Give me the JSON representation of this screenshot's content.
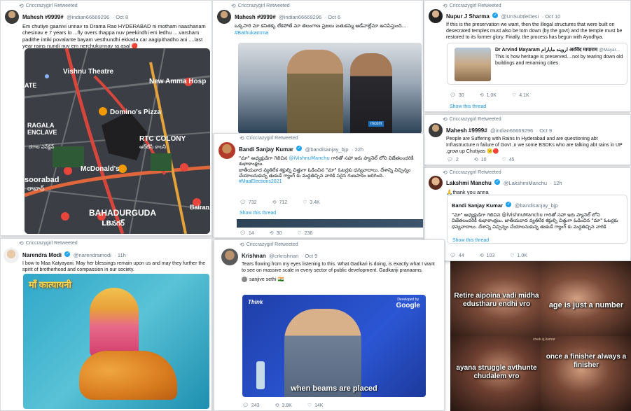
{
  "tweets": {
    "t1": {
      "retweet_label": "Criccrazygirl Retweeted",
      "name": "Mahesh #9999#",
      "handle": "@indian66669296",
      "date": "· Oct 8",
      "text": "Em chutiye gaanivi unnav ra Drama Rao HYDERABAD ni motham naashanam chesinav e 7 years lo ...fly overs thappa nuv peekindhi em ledhu ....varsham padithe intiki povalante bayam vesthundhi ekkada car aagipithadho ani ....last year rains nundi nuv em nerchukunnav ra asal 🔴",
      "map": {
        "labels": [
          "Vishnu Theatre",
          "New Amma Hosp",
          "Domino's Pizza",
          "RAGALA ENCLAVE",
          "రగాల ఎన్‌క్లేవ్",
          "RTC COLONY",
          "ఆర్‌టీసీ కాలనీ",
          "McDonald's",
          "soorabad",
          "రాబాద్",
          "BAHADURGUDA",
          "LBనగర్",
          "Bairan",
          "ATE"
        ]
      }
    },
    "t2": {
      "retweet_label": "Criccrazygirl Retweeted",
      "name": "Mahesh #9999#",
      "handle": "@indian66669296",
      "date": "· Oct 6",
      "text": "ఒక్కసారి మా కవితక్క లేకపోతే మా తెలంగాణ ప్రజలు బతుకమ్మ ఆడేవాల్లేమా అనిపిస్తుంది...",
      "hashtag": "#Bathukamma",
      "badges": [
        "mcom",
        "mcom"
      ]
    },
    "t3": {
      "retweet_label": "Criccrazygirl Retweeted",
      "name": "Nupur J Sharma",
      "handle": "@UnSubtleDesi",
      "date": "· Oct 10",
      "text": "If this is the preservation we want, then the illegal structures that were built on desecrated temples must also be torn down (by the govt) and the temple must be restored to its former glory. Finally, the process has begun with Ayodhya.",
      "quote_name": "Dr Arvind Mayaram ارویند مایارام अरविंद मायाराम",
      "quote_handle": "@Mayar...",
      "quote_text": "This is how heritage is preserved....not by tearing down old buildings and renaming cities.",
      "replies": "30",
      "retweets": "1.0K",
      "likes": "4.1K",
      "show_thread": "Show this thread"
    },
    "t4": {
      "retweet_label": "Criccrazygirl Retweeted",
      "name": "Bandi Sanjay Kumar",
      "handle": "@bandisanjay_bjp",
      "date": "· 22h",
      "text_line1": "\"మా\" అధ్యక్షుడిగా గెలిచిన",
      "mention": "@iVishnuManchu",
      "text_line1b": "గారితో సహా ఇరు ప్యానెల్ లోని విజేతలందరికీ శుభాకాంక్షలు.",
      "text_rest": "జాతీయవాద వ్యతిరేక శక్తుల్ని చిత్తుగా ఓడించిన \"మా\" ఓటర్లకు ధన్యవాదాలు. దేశాన్ని విచ్చిన్నం చేయాలనుకున్న తుకుడే గ్యాంగ్ కు మద్దతిచ్చిన వారికి సరైన గుణపాఠం జరిగింది.",
      "hashtag": "#MaaElections2021",
      "replies": "732",
      "retweets": "712",
      "likes": "3.4K",
      "show_thread": "Show this thread",
      "under_replies": "14",
      "under_retweets": "30",
      "under_likes": "236"
    },
    "t5": {
      "retweet_label": "Criccrazygirl Retweeted",
      "name": "Mahesh #9999#",
      "handle": "@indian66669296",
      "date": "· Oct 9",
      "text": "People are Suffering with Rains in Hyderabad and are questioning abt Infrastructure n failure of Govt ,n we some BSDKs who are talking abt rains in UP ,grow up Chutiyas 😕🔴",
      "replies": "2",
      "retweets": "10",
      "likes": "45"
    },
    "t6": {
      "retweet_label": "Criccrazygirl Retweeted",
      "name": "Lakshmi Manchu",
      "handle": "@LakshmiManchu",
      "date": "· 12h",
      "text": "🙏thank you anna",
      "quote_name": "Bandi Sanjay Kumar",
      "quote_handle": "@bandisanjay_bjp",
      "quote_text": "\"మా\" అధ్యక్షుడిగా గెలిచిన @iVishnuManchu గారితో సహా ఇరు ప్యానెల్ లోని విజేతలందరికీ శుభాకాంక్షలు. జాతీయవాద వ్యతిరేక శక్తుల్ని చిత్తుగా ఓడించిన \"మా\" ఓటర్లకు ధన్యవాదాలు. దేశాన్ని విచ్చిన్నం చేయాలనుకున్న తుకుడే గ్యాంగ్ కు మద్దతిచ్చిన వారికి",
      "show_thread": "Show this thread",
      "replies": "44",
      "retweets": "103",
      "likes": "1.0K"
    },
    "t7": {
      "retweet_label": "Criccrazygirl Retweeted",
      "name": "Narendra Modi",
      "handle": "@narendramodi",
      "date": "· 11h",
      "text": "I bow to Maa Katyayani. May her blessings remain upon us and may they further the spirit of brotherhood and compassion in our society.",
      "image_caption": "माँ कात्यायनी"
    },
    "t8": {
      "retweet_label": "Criccrazygirl Retweeted",
      "name": "Krishnan",
      "handle": "@crkrishnan",
      "date": "· Oct 9",
      "text": "Tears flowing from my eyes listening to this. What Gadkari is doing, is exactly what I want to see on massive scale in every sector of public development. Gadkariji pranaams.",
      "tagged": "sanjive sethi 🇮🇳",
      "video_caption": "when beams are placed",
      "video_brand": "Google",
      "video_logo": "Think",
      "video_dev": "Developed by",
      "replies": "243",
      "retweets": "3.8K",
      "likes": "14K"
    }
  },
  "meme": {
    "captions": [
      "Retire aipoina vadi midha edustharu endhi vro",
      "age is just a number",
      "ayana struggle avthunte chudalem vro",
      "once a finisher always a finisher"
    ],
    "watermark": "vivek.vj.kumar"
  },
  "colors": {
    "link": "#1b95e0",
    "muted": "#657786",
    "verified": "#1da1f2",
    "map_bg": "#3a3d42"
  }
}
